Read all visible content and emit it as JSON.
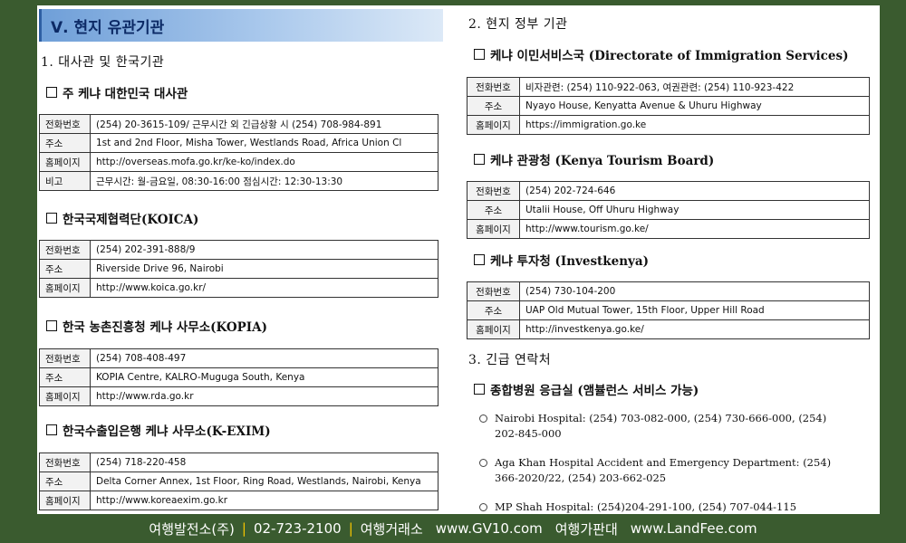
{
  "left": {
    "banner": "Ⅴ. 현지 유관기관",
    "section1": "1. 대사관 및 한국기관",
    "embassy": {
      "title": "주 케냐 대한민국 대사관",
      "rows": [
        {
          "label": "전화번호",
          "value": "(254) 20-3615-109/ 근무시간 외 긴급상황 시 (254) 708-984-891"
        },
        {
          "label": "주소",
          "value": "1st and 2nd Floor, Misha Tower, Westlands Road, Africa Union Cl"
        },
        {
          "label": "홈페이지",
          "value": "http://overseas.mofa.go.kr/ke-ko/index.do"
        },
        {
          "label": "비고",
          "value": "근무시간: 월-금요일, 08:30-16:00 점심시간: 12:30-13:30"
        }
      ]
    },
    "koica": {
      "title": "한국국제협력단(KOICA)",
      "rows": [
        {
          "label": "전화번호",
          "value": "(254) 202-391-888/9"
        },
        {
          "label": "주소",
          "value": "Riverside Drive 96, Nairobi"
        },
        {
          "label": "홈페이지",
          "value": "http://www.koica.go.kr/"
        }
      ]
    },
    "kopia": {
      "title": "한국 농촌진흥청 케냐 사무소(KOPIA)",
      "rows": [
        {
          "label": "전화번호",
          "value": "(254) 708-408-497"
        },
        {
          "label": "주소",
          "value": "KOPIA Centre, KALRO-Muguga South, Kenya"
        },
        {
          "label": "홈페이지",
          "value": "http://www.rda.go.kr"
        }
      ]
    },
    "kexim": {
      "title": "한국수출입은행 케냐 사무소(K-EXIM)",
      "rows": [
        {
          "label": "전화번호",
          "value": "(254) 718-220-458"
        },
        {
          "label": "주소",
          "value": "Delta Corner Annex, 1st Floor, Ring Road, Westlands, Nairobi, Kenya"
        },
        {
          "label": "홈페이지",
          "value": "http://www.koreaexim.go.kr"
        }
      ]
    }
  },
  "right": {
    "section2": "2. 현지 정부 기관",
    "immigration": {
      "title": "케냐 이민서비스국 (Directorate of Immigration Services)",
      "rows": [
        {
          "label": "전화번호",
          "value": "비자관련: (254) 110-922-063, 여권관련: (254) 110-923-422"
        },
        {
          "label": "주소",
          "value": "Nyayo House, Kenyatta Avenue & Uhuru Highway"
        },
        {
          "label": "홈페이지",
          "value": "https://immigration.go.ke"
        }
      ]
    },
    "tourism": {
      "title": "케냐 관광청 (Kenya Tourism Board)",
      "rows": [
        {
          "label": "전화번호",
          "value": "(254) 202-724-646"
        },
        {
          "label": "주소",
          "value": "Utalii House, Off Uhuru Highway"
        },
        {
          "label": "홈페이지",
          "value": "http://www.tourism.go.ke/"
        }
      ]
    },
    "invest": {
      "title": "케냐 투자청 (Investkenya)",
      "rows": [
        {
          "label": "전화번호",
          "value": "(254) 730-104-200"
        },
        {
          "label": "주소",
          "value": "UAP Old Mutual Tower, 15th Floor, Upper Hill Road"
        },
        {
          "label": "홈페이지",
          "value": "http://investkenya.go.ke/"
        }
      ]
    },
    "section3": "3. 긴급 연락처",
    "emergency": {
      "title": "종합병원 응급실 (앰뷸런스 서비스 가능)",
      "items": [
        {
          "line1": "Nairobi Hospital: (254) 703-082-000, (254) 730-666-000, (254)",
          "line2": "202-845-000"
        },
        {
          "line1": "Aga Khan Hospital Accident and Emergency Department: (254)",
          "line2": "366-2020/22, (254) 203-662-025"
        },
        {
          "line1": "MP Shah Hospital: (254)204-291-100, (254) 707-044-115",
          "line2": ""
        }
      ]
    }
  },
  "footer": {
    "company": "여행발전소(주)",
    "phone": "02-723-2100",
    "label1": "여행거래소",
    "site1": "www.GV10.com",
    "label2": "여행가판대",
    "site2": "www.LandFee.com"
  },
  "colors": {
    "background": "#3a5b2f",
    "banner_start": "#6f9fd8",
    "banner_text": "#0c2a66",
    "footer_separator": "#f5c400"
  }
}
